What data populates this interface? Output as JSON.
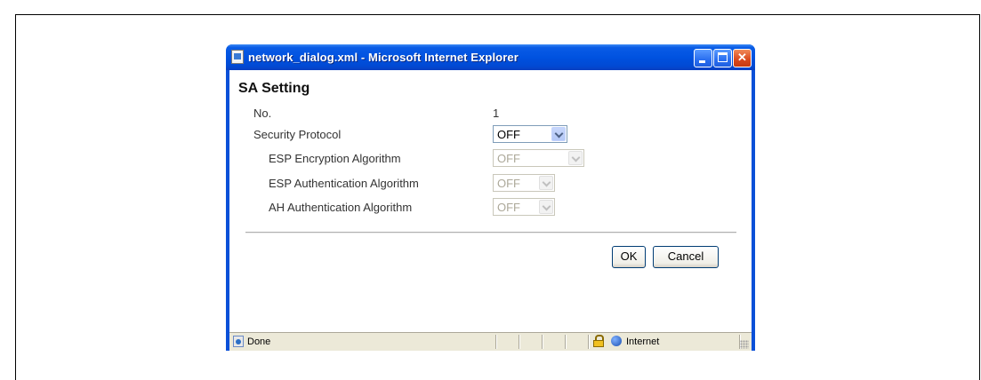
{
  "window": {
    "title": "network_dialog.xml - Microsoft Internet Explorer",
    "controls": {
      "minimize": "minimize",
      "maximize": "maximize",
      "close": "✕"
    }
  },
  "dialog": {
    "heading": "SA Setting",
    "fields": {
      "no_label": "No.",
      "no_value": "1",
      "security_protocol_label": "Security Protocol",
      "security_protocol_value": "OFF",
      "esp_encryption_label": "ESP Encryption Algorithm",
      "esp_encryption_value": "OFF",
      "esp_auth_label": "ESP Authentication Algorithm",
      "esp_auth_value": "OFF",
      "ah_auth_label": "AH Authentication Algorithm",
      "ah_auth_value": "OFF"
    },
    "buttons": {
      "ok": "OK",
      "cancel": "Cancel"
    }
  },
  "statusbar": {
    "status": "Done",
    "zone": "Internet",
    "icons": [
      "page-done-icon",
      "lock-icon",
      "globe-icon"
    ]
  }
}
